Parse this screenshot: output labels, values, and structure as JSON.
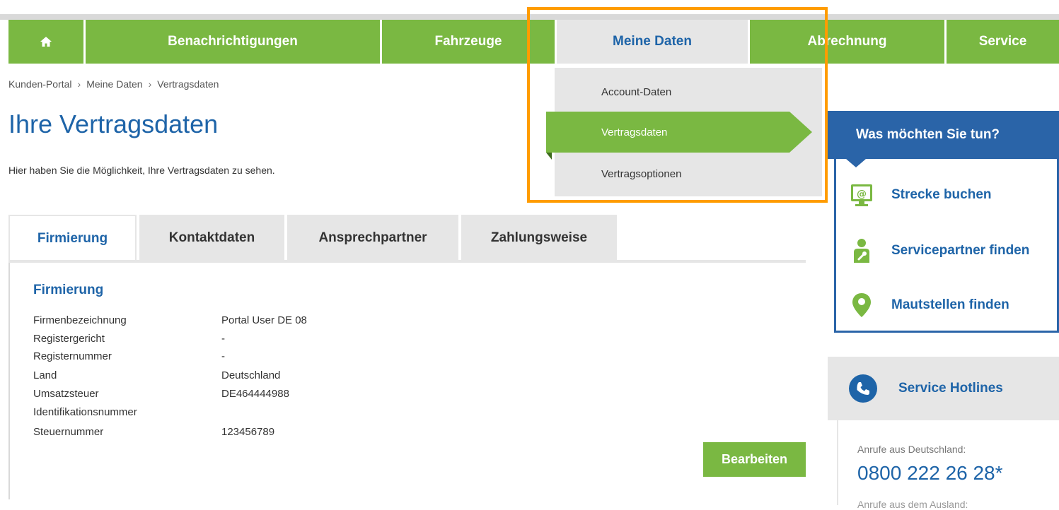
{
  "nav": {
    "home_icon": "home-icon",
    "items": [
      {
        "label": "Benachrichtigungen"
      },
      {
        "label": "Fahrzeuge"
      },
      {
        "label": "Meine Daten"
      },
      {
        "label": "Abrechnung"
      },
      {
        "label": "Service"
      }
    ],
    "accent_color": "#7ab842",
    "active_color": "#1e64a8"
  },
  "dropdown": {
    "items": [
      "Account-Daten",
      "Vertragsdaten",
      "Vertragsoptionen"
    ],
    "active": "Vertragsdaten"
  },
  "breadcrumb": [
    "Kunden-Portal",
    "Meine Daten",
    "Vertragsdaten"
  ],
  "page": {
    "title": "Ihre Vertragsdaten",
    "intro": "Hier haben Sie die Möglichkeit, Ihre Vertragsdaten zu sehen."
  },
  "tabs": [
    "Firmierung",
    "Kontaktdaten",
    "Ansprechpartner",
    "Zahlungsweise"
  ],
  "section": {
    "title": "Firmierung",
    "fields": [
      {
        "label": "Firmenbezeichnung",
        "value": "Portal User DE 08"
      },
      {
        "label": "Registergericht",
        "value": "-"
      },
      {
        "label": "Registernummer",
        "value": "-"
      },
      {
        "label": "Land",
        "value": "Deutschland"
      },
      {
        "label": "Umsatzsteuer",
        "value": "DE464444988"
      },
      {
        "label": "Identifikationsnummer",
        "value": ""
      },
      {
        "label": "Steuernummer",
        "value": "123456789"
      }
    ],
    "edit_label": "Bearbeiten"
  },
  "sidebar": {
    "title": "Was möchten Sie tun?",
    "links": [
      {
        "label": "Strecke buchen",
        "icon": "monitor-at-icon"
      },
      {
        "label": "Servicepartner finden",
        "icon": "mechanic-icon"
      },
      {
        "label": "Mautstellen finden",
        "icon": "map-pin-icon"
      }
    ],
    "hotline": {
      "title": "Service Hotlines",
      "icon": "phone-icon",
      "label": "Anrufe aus Deutschland:",
      "number": "0800 222 26 28*",
      "label2": "Anrufe aus dem Ausland:"
    }
  }
}
